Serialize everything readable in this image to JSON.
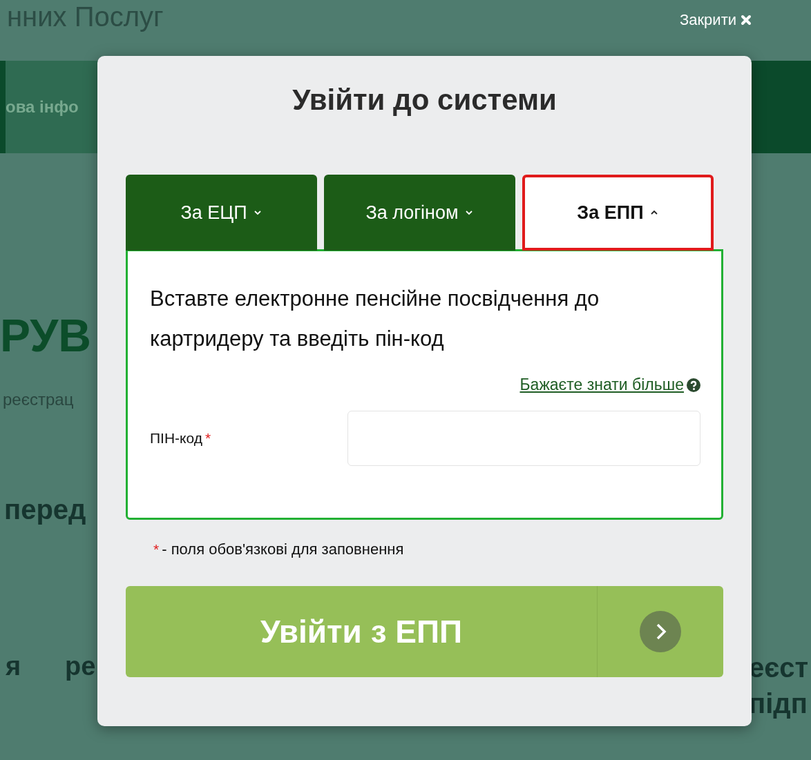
{
  "header": {
    "site_title": "нних Послуг",
    "close_label": "Закрити"
  },
  "background": {
    "nav_item": "ова інфо",
    "heading": "РУВ",
    "subtitle": "реєстрац",
    "section_heading": "перед",
    "row_words": [
      "я",
      "ре"
    ],
    "right_words": [
      "еєст",
      "підп"
    ]
  },
  "dialog": {
    "title": "Увійти до системи",
    "tabs": [
      {
        "label": "За ЕЦП",
        "selected": false
      },
      {
        "label": "За логіном",
        "selected": false
      },
      {
        "label": "За ЕПП",
        "selected": true
      }
    ],
    "instruction": "Вставте електронне пенсійне посвідчення до картридеру та введіть пін-код",
    "help_link": "Бажаєте знати більше",
    "pin_field": {
      "label": "ПІН-код",
      "required_mark": "*"
    },
    "required_note": {
      "mark": "*",
      "text": "- поля обов'язкові для заповнення"
    },
    "submit_button": "Увійти з ЕПП"
  }
}
